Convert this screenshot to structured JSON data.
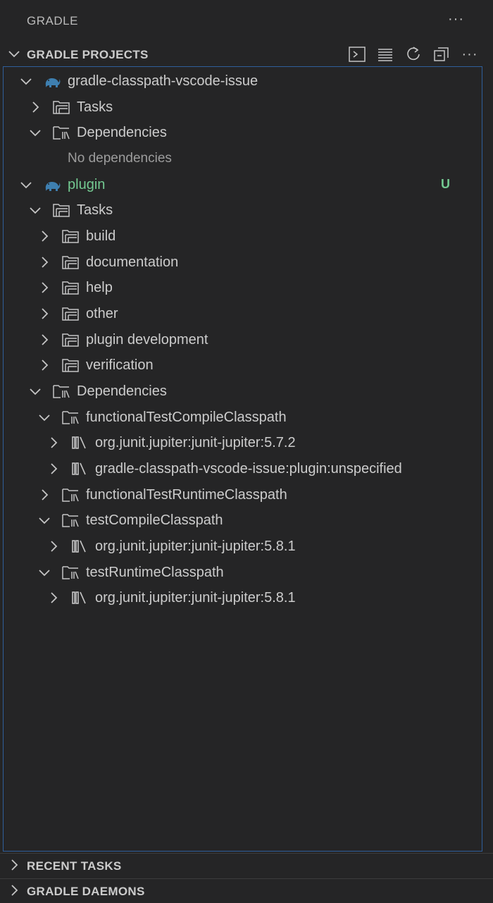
{
  "panel": {
    "title": "GRADLE",
    "more": "···"
  },
  "sections": {
    "projects": {
      "label": "GRADLE PROJECTS"
    },
    "recent": {
      "label": "RECENT TASKS"
    },
    "daemons": {
      "label": "GRADLE DAEMONS"
    }
  },
  "toolbar": {
    "icons": [
      "terminal-icon",
      "list-icon",
      "refresh-icon",
      "collapse-all-icon",
      "more-icon"
    ],
    "more": "···"
  },
  "tree": {
    "r0": {
      "label": "gradle-classpath-vscode-issue"
    },
    "r1": {
      "label": "Tasks"
    },
    "r2": {
      "label": "Dependencies"
    },
    "r3": {
      "label": "No dependencies"
    },
    "r4": {
      "label": "plugin",
      "badge": "U"
    },
    "r5": {
      "label": "Tasks"
    },
    "r6": {
      "label": "build"
    },
    "r7": {
      "label": "documentation"
    },
    "r8": {
      "label": "help"
    },
    "r9": {
      "label": "other"
    },
    "r10": {
      "label": "plugin development"
    },
    "r11": {
      "label": "verification"
    },
    "r12": {
      "label": "Dependencies"
    },
    "r13": {
      "label": "functionalTestCompileClasspath"
    },
    "r14": {
      "label": "org.junit.jupiter:junit-jupiter:5.7.2"
    },
    "r15": {
      "label": "gradle-classpath-vscode-issue:plugin:unspecified"
    },
    "r16": {
      "label": "functionalTestRuntimeClasspath"
    },
    "r17": {
      "label": "testCompileClasspath"
    },
    "r18": {
      "label": "org.junit.jupiter:junit-jupiter:5.8.1"
    },
    "r19": {
      "label": "testRuntimeClasspath"
    },
    "r20": {
      "label": "org.junit.jupiter:junit-jupiter:5.8.1"
    }
  },
  "colors": {
    "accent_green": "#73c991",
    "focus_border": "#2f5f9b",
    "elephant": "#3e7fb0"
  }
}
